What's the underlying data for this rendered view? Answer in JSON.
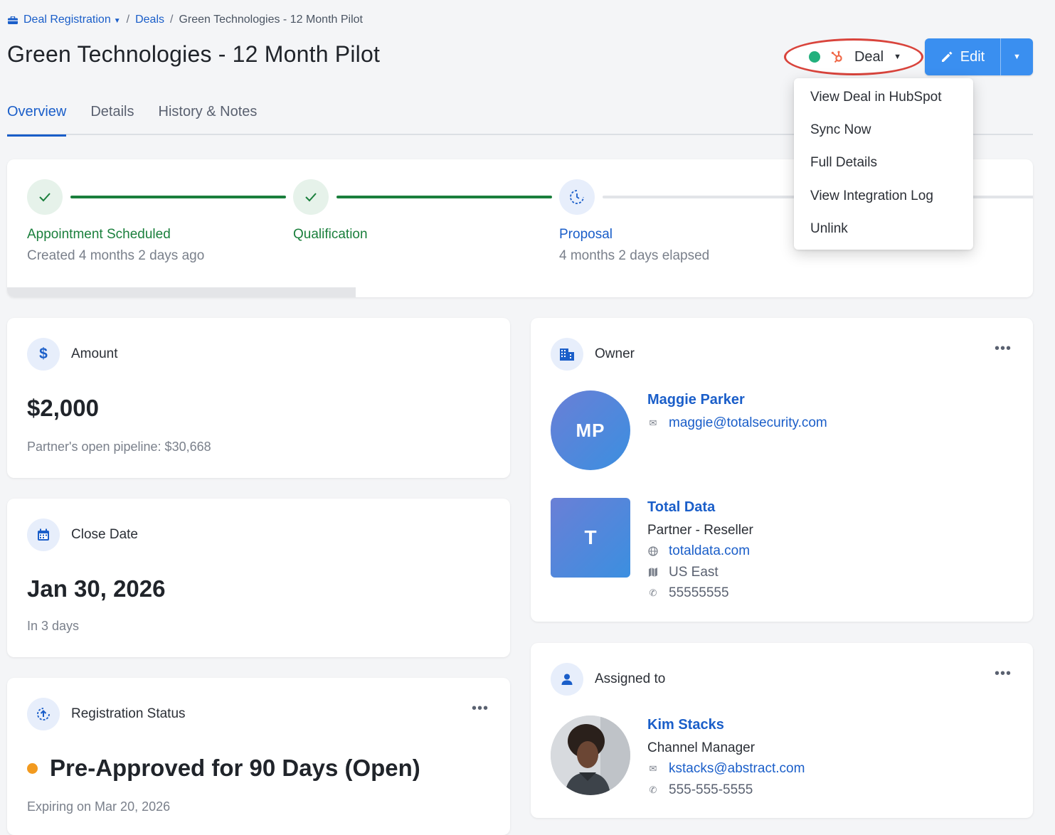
{
  "breadcrumb": {
    "root": "Deal Registration",
    "section": "Deals",
    "current": "Green Technologies - 12 Month Pilot"
  },
  "page": {
    "title": "Green Technologies - 12 Month Pilot"
  },
  "header_actions": {
    "integration_label": "Deal",
    "integration_status_color": "#22b07d",
    "edit_label": "Edit"
  },
  "tabs": [
    {
      "label": "Overview",
      "active": true
    },
    {
      "label": "Details",
      "active": false
    },
    {
      "label": "History & Notes",
      "active": false
    }
  ],
  "pipeline": {
    "progress_percent": 34,
    "stages": [
      {
        "name": "Appointment Scheduled",
        "sub": "Created 4 months 2 days ago",
        "state": "done"
      },
      {
        "name": "Qualification",
        "sub": "",
        "state": "done"
      },
      {
        "name": "Proposal",
        "sub": "4 months 2 days elapsed",
        "state": "current"
      }
    ]
  },
  "amount": {
    "label": "Amount",
    "value": "$2,000",
    "sub": "Partner's open pipeline: $30,668"
  },
  "close_date": {
    "label": "Close Date",
    "value": "Jan 30, 2026",
    "sub": "In 3 days"
  },
  "registration_status": {
    "label": "Registration Status",
    "value": "Pre-Approved for 90 Days (Open)",
    "sub": "Expiring on Mar 20, 2026",
    "status_color": "#f29a1f"
  },
  "owner": {
    "label": "Owner",
    "person": {
      "initials": "MP",
      "name": "Maggie Parker",
      "email": "maggie@totalsecurity.com"
    },
    "company": {
      "initial": "T",
      "name": "Total Data",
      "type": "Partner - Reseller",
      "website": "totaldata.com",
      "region": "US East",
      "phone": "55555555"
    }
  },
  "assigned": {
    "label": "Assigned to",
    "name": "Kim Stacks",
    "title": "Channel Manager",
    "email": "kstacks@abstract.com",
    "phone": "555-555-5555"
  },
  "dropdown": {
    "items": [
      "View Deal in HubSpot",
      "Sync Now",
      "Full Details",
      "View Integration Log",
      "Unlink"
    ]
  },
  "more_label": "•••"
}
